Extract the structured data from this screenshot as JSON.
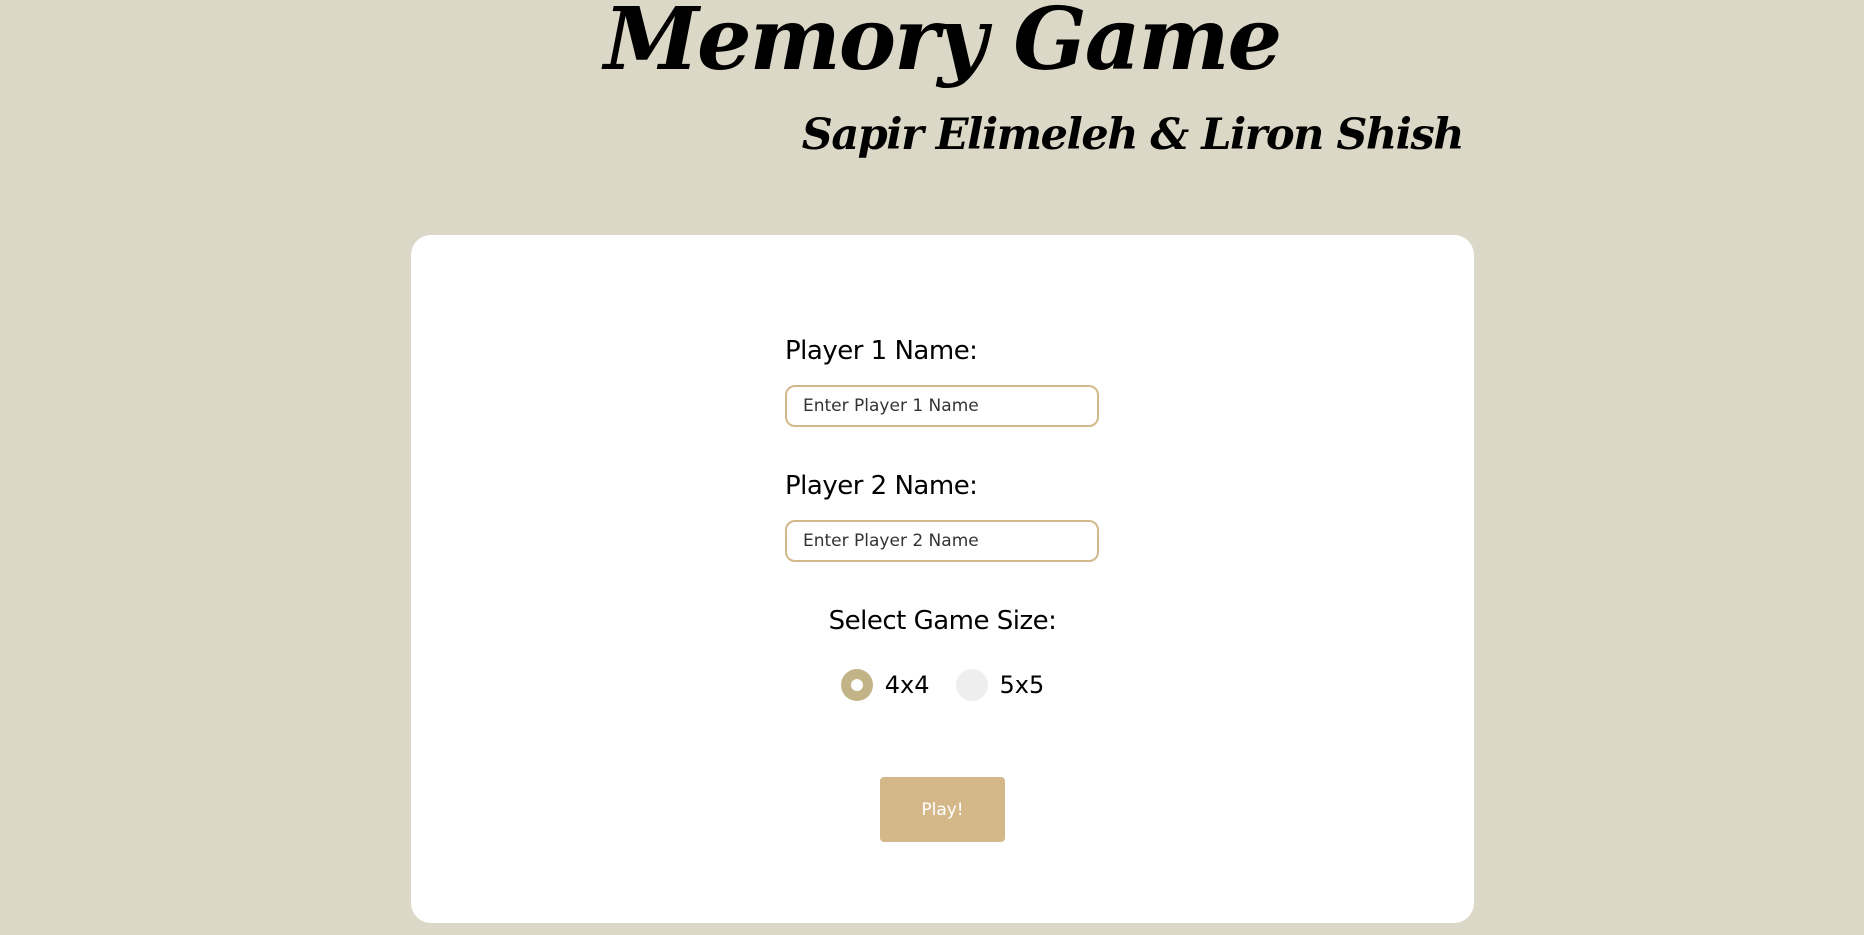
{
  "header": {
    "title": "Memory Game",
    "authors": "Sapir Elimeleh & Liron Shish"
  },
  "form": {
    "player1": {
      "label": "Player 1 Name:",
      "placeholder": "Enter Player 1 Name",
      "value": ""
    },
    "player2": {
      "label": "Player 2 Name:",
      "placeholder": "Enter Player 2 Name",
      "value": ""
    },
    "game_size": {
      "label": "Select Game Size:",
      "options": [
        {
          "label": "4x4",
          "selected": true
        },
        {
          "label": "5x5",
          "selected": false
        }
      ]
    },
    "play_label": "Play!"
  },
  "colors": {
    "page_background": "#dcd8c8",
    "card_background": "#ffffff",
    "input_border": "#d3b88b",
    "radio_selected": "#c2b487",
    "radio_unselected": "#eeeeee",
    "button_background": "#d4b88a",
    "button_text": "#ffffff"
  }
}
